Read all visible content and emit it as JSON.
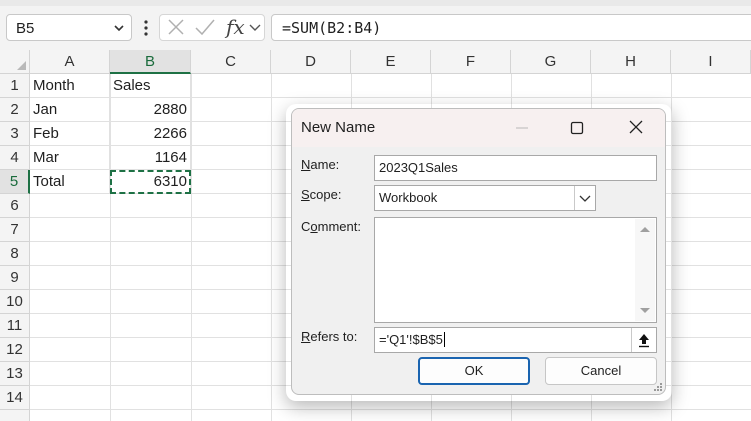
{
  "formula_bar": {
    "name_box": "B5",
    "fx_label": "fx",
    "formula": "=SUM(B2:B4)"
  },
  "sheet": {
    "columns": [
      "A",
      "B",
      "C",
      "D",
      "E",
      "F",
      "G",
      "H",
      "I"
    ],
    "rows": [
      "1",
      "2",
      "3",
      "4",
      "5",
      "6",
      "7",
      "8",
      "9",
      "10",
      "11",
      "12",
      "13",
      "14"
    ],
    "selected_cell": "B5",
    "cells": {
      "A1": "Month",
      "B1": "Sales",
      "A2": "Jan",
      "B2": "2880",
      "A3": "Feb",
      "B3": "2266",
      "A4": "Mar",
      "B4": "1164",
      "A5": "Total",
      "B5": "6310"
    }
  },
  "dialog": {
    "title": "New Name",
    "name_label_key": "N",
    "name_label_rest": "ame:",
    "name_value": "2023Q1Sales",
    "scope_label_key": "S",
    "scope_label_rest": "cope:",
    "scope_value": "Workbook",
    "comment_label_pre": "C",
    "comment_label_key": "o",
    "comment_label_rest": "mment:",
    "comment_value": "",
    "refers_label_key": "R",
    "refers_label_rest": "efers to:",
    "refers_value": "='Q1'!$B$5",
    "ok_label": "OK",
    "cancel_label": "Cancel"
  },
  "colors": {
    "selection_green": "#1e7145",
    "primary_button_border": "#1a64b0"
  }
}
